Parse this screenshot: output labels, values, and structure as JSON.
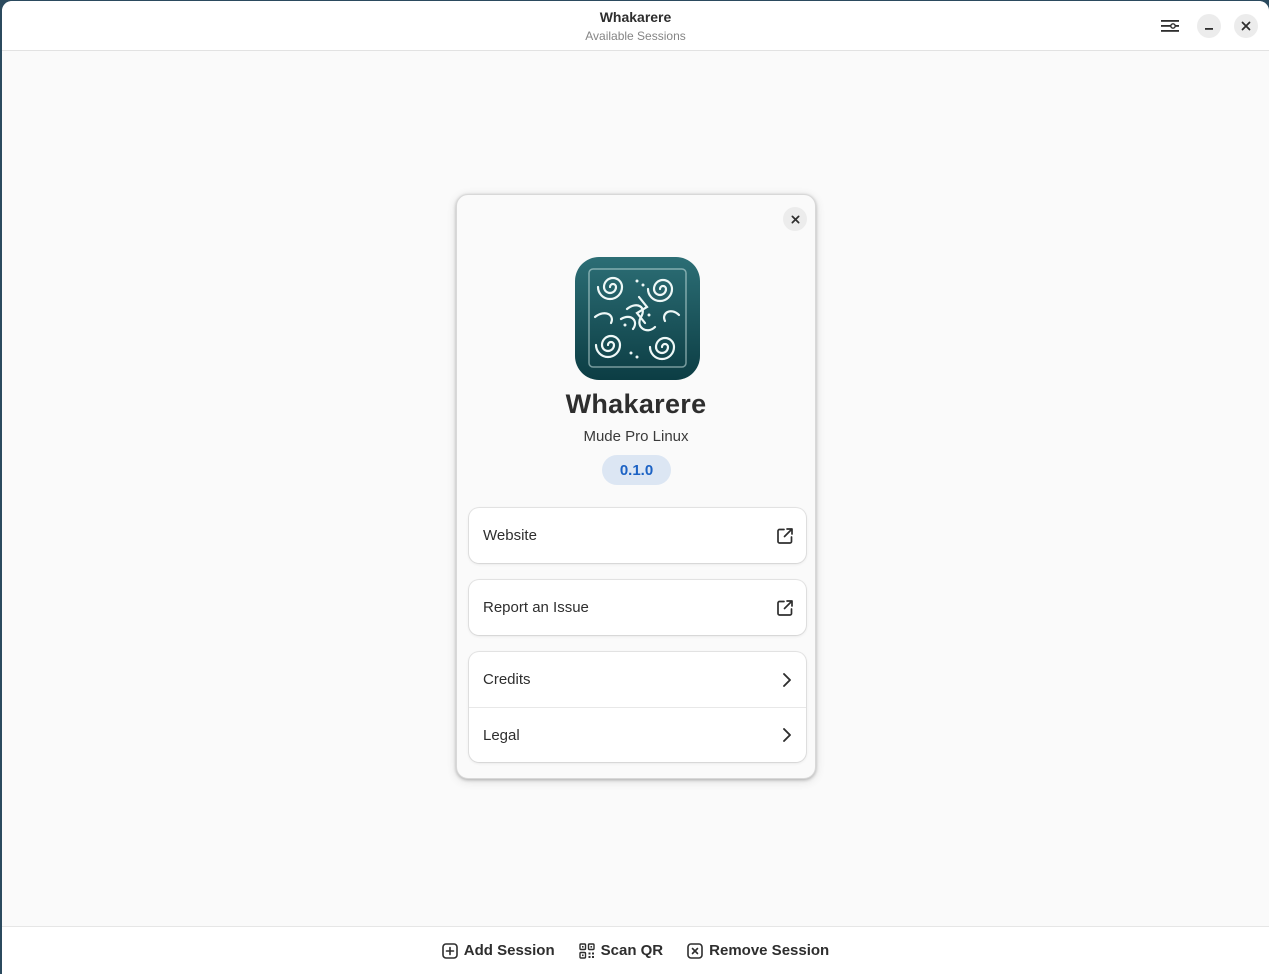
{
  "window": {
    "title": "Whakarere",
    "subtitle": "Available Sessions"
  },
  "header_buttons": {
    "menu_icon": "hamburger-menu-icon",
    "minimize_icon": "minimize-icon",
    "close_icon": "close-icon"
  },
  "about": {
    "app_name": "Whakarere",
    "developer": "Mude Pro Linux",
    "version": "0.1.0",
    "icon": "whakarere-app-icon",
    "links": [
      {
        "label": "Website",
        "icon": "external-link-icon"
      },
      {
        "label": "Report an Issue",
        "icon": "external-link-icon"
      }
    ],
    "pages": [
      {
        "label": "Credits",
        "icon": "chevron-right-icon"
      },
      {
        "label": "Legal",
        "icon": "chevron-right-icon"
      }
    ]
  },
  "footer": {
    "add_session": "Add Session",
    "scan_qr": "Scan QR",
    "remove_session": "Remove Session"
  },
  "colors": {
    "accent": "#1c62c4",
    "icon_bg": "#0f4a52"
  }
}
